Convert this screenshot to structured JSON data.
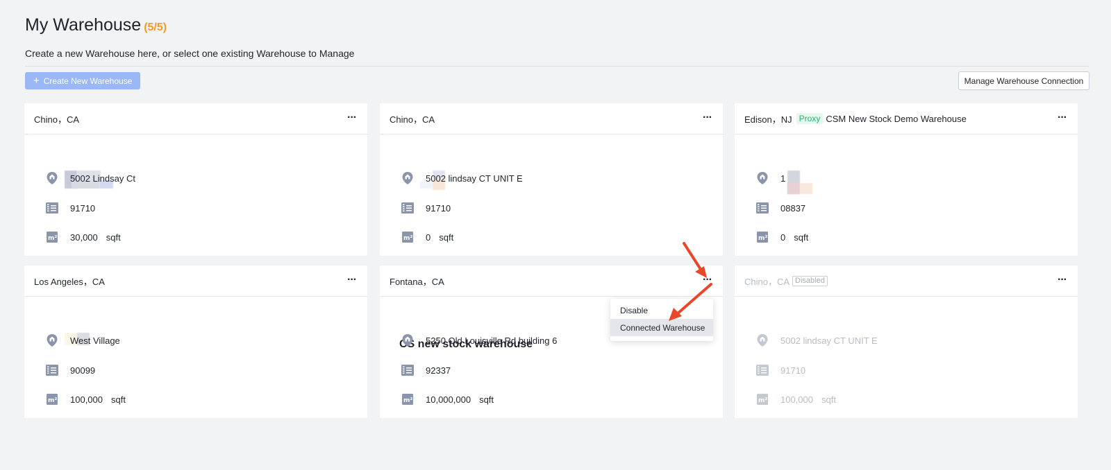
{
  "header": {
    "title": "My Warehouse",
    "count": "(5/5)",
    "subtitle": "Create a new Warehouse here, or select one existing Warehouse to Manage"
  },
  "toolbar": {
    "create_label": "Create New Warehouse",
    "manage_label": "Manage Warehouse Connection"
  },
  "colors": {
    "accent": "#f59a23",
    "create_button": "#9ab8f5",
    "icon": "#8a94ab",
    "arrow": "#e8472a"
  },
  "cards": [
    {
      "location": "Chino，CA",
      "address": "5002 Lindsay Ct",
      "zip": "91710",
      "area": "30,000",
      "unit": "sqft"
    },
    {
      "location": "Chino，CA",
      "address": "5002 lindsay CT UNIT E",
      "zip": "91710",
      "area": "0",
      "unit": "sqft"
    },
    {
      "location": "Edison，NJ",
      "tag": "Proxy",
      "tag_name": "CSM New Stock Demo Warehouse",
      "address": "1",
      "zip": "08837",
      "area": "0",
      "unit": "sqft"
    },
    {
      "location": "Los Angeles，CA",
      "address": "West Village",
      "zip": "90099",
      "area": "100,000",
      "unit": "sqft"
    },
    {
      "location": "Fontana，CA",
      "name": "CS new stock warehouse",
      "address": "5250 Old Louisville Rd building 6",
      "zip": "92337",
      "area": "10,000,000",
      "unit": "sqft"
    },
    {
      "location": "Chino，CA",
      "status": "Disabled",
      "address": "5002 lindsay CT UNIT E",
      "zip": "91710",
      "area": "100,000",
      "unit": "sqft"
    }
  ],
  "dropdown": {
    "items": [
      "Disable",
      "Connected Warehouse"
    ]
  },
  "icons": {
    "address": "location-pin-icon",
    "zip": "zip-code-icon",
    "area": "square-meter-icon",
    "more": "more-dots-icon"
  }
}
